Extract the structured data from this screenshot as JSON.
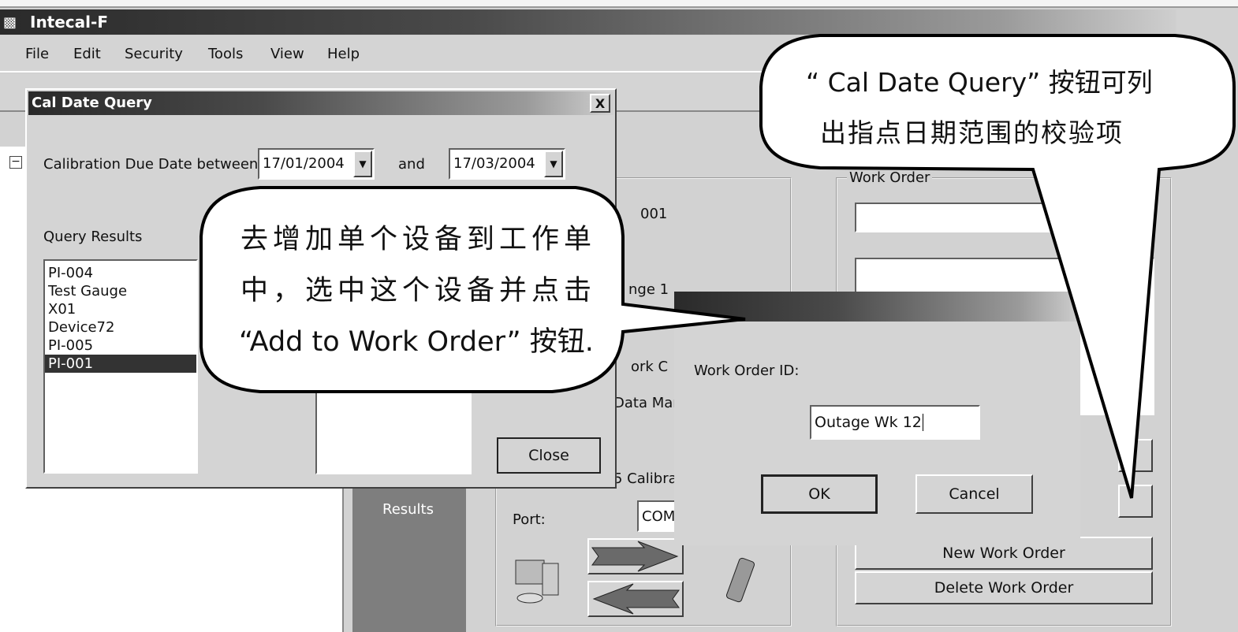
{
  "app": {
    "title": "Intecal-F",
    "icon": "app-icon"
  },
  "menu": [
    "File",
    "Edit",
    "Security",
    "Tools",
    "View",
    "Help"
  ],
  "cal_dialog": {
    "title": "Cal Date Query",
    "close": "X",
    "due_label": "Calibration Due Date between",
    "from_date": "17/01/2004",
    "and_label": "and",
    "to_date": "17/03/2004",
    "results_label": "Query Results",
    "results": [
      "PI-004",
      "Test Gauge",
      "X01",
      "Device72",
      "PI-005",
      "PI-001"
    ],
    "selected": "PI-001",
    "close_button": "Close"
  },
  "background": {
    "results_tab": "Results",
    "frag_001": "001",
    "frag_range": "nge 1",
    "frag_work": "ork C",
    "frag_data": "Data Mar",
    "frag_calib": "5 Calibra",
    "port_label": "Port:",
    "port_value": "COM",
    "work_order_group": "Work Order",
    "new_work_order": "New Work Order",
    "delete_work_order": "Delete Work Order"
  },
  "wo_dialog": {
    "id_label": "Work Order ID:",
    "id_value": "Outage Wk 12",
    "ok": "OK",
    "cancel": "Cancel"
  },
  "callouts": {
    "left": [
      "去增加单个设备到工作单",
      "中，选中这个设备并点击",
      "“Add to Work Order” 按钮."
    ],
    "right": [
      "“ Cal Date Query” 按钮可列",
      "出指点日期范围的校验项"
    ]
  }
}
